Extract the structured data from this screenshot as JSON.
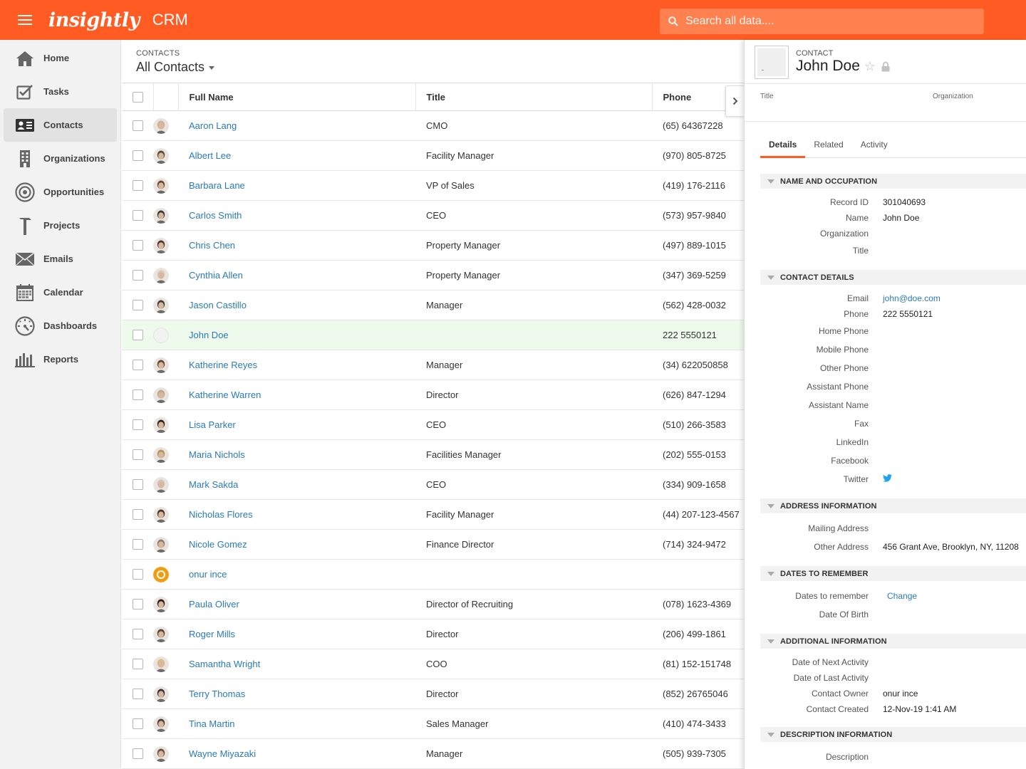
{
  "topbar": {
    "logo": "insightly",
    "product": "CRM",
    "search_placeholder": "Search all data...."
  },
  "sidebar": {
    "items": [
      {
        "label": "Home",
        "icon": "home-icon"
      },
      {
        "label": "Tasks",
        "icon": "tasks-icon"
      },
      {
        "label": "Contacts",
        "icon": "contacts-icon",
        "active": true
      },
      {
        "label": "Organizations",
        "icon": "building-icon"
      },
      {
        "label": "Opportunities",
        "icon": "target-icon"
      },
      {
        "label": "Projects",
        "icon": "hammer-icon"
      },
      {
        "label": "Emails",
        "icon": "envelope-icon"
      },
      {
        "label": "Calendar",
        "icon": "calendar-icon"
      },
      {
        "label": "Dashboards",
        "icon": "gauge-icon"
      },
      {
        "label": "Reports",
        "icon": "bar-chart-icon"
      }
    ]
  },
  "list": {
    "crumb": "CONTACTS",
    "view_title": "All Contacts",
    "columns": [
      "Full Name",
      "Title",
      "Phone"
    ],
    "rows": [
      {
        "name": "Aaron Lang",
        "title": "CMO",
        "phone": "(65) 64367228",
        "avatar": "#c9b39d"
      },
      {
        "name": "Albert Lee",
        "title": "Facility Manager",
        "phone": "(970) 805-8725",
        "avatar": "#5a4a44"
      },
      {
        "name": "Barbara Lane",
        "title": "VP of Sales",
        "phone": "(419) 176-2116",
        "avatar": "#6b4a35"
      },
      {
        "name": "Carlos Smith",
        "title": "CEO",
        "phone": "(573) 957-9840",
        "avatar": "#3a3a3a"
      },
      {
        "name": "Chris Chen",
        "title": "Property Manager",
        "phone": "(497) 889-1015",
        "avatar": "#4a3a30"
      },
      {
        "name": "Cynthia Allen",
        "title": "Property Manager",
        "phone": "(347) 369-5259",
        "avatar": "#d8c8b8"
      },
      {
        "name": "Jason Castillo",
        "title": "Manager",
        "phone": "(562) 428-0032",
        "avatar": "#3f3f3f"
      },
      {
        "name": "John Doe",
        "title": "",
        "phone": "222 5550121",
        "avatar": "#eeeeee",
        "selected": true
      },
      {
        "name": "Katherine Reyes",
        "title": "Manager",
        "phone": "(34) 622050858",
        "avatar": "#5b4637"
      },
      {
        "name": "Katherine Warren",
        "title": "Director",
        "phone": "(626) 847-1294",
        "avatar": "#c0a890"
      },
      {
        "name": "Lisa Parker",
        "title": "CEO",
        "phone": "(510) 266-3583",
        "avatar": "#2f2622"
      },
      {
        "name": "Maria Nichols",
        "title": "Facilities Manager",
        "phone": "(202) 555-0153",
        "avatar": "#b8925e"
      },
      {
        "name": "Mark Sakda",
        "title": "CEO",
        "phone": "(334) 909-1658",
        "avatar": "#cfc3b8"
      },
      {
        "name": "Nicholas Flores",
        "title": "Facility Manager",
        "phone": "(44) 207-123-4567",
        "avatar": "#4a3528"
      },
      {
        "name": "Nicole Gomez",
        "title": "Finance Director",
        "phone": "(714) 324-9472",
        "avatar": "#8c7d70"
      },
      {
        "name": "onur ince",
        "title": "",
        "phone": "",
        "avatar": "#f39c12",
        "initial": "O"
      },
      {
        "name": "Paula Oliver",
        "title": "Director of Recruiting",
        "phone": "(078) 1623-4369",
        "avatar": "#2e1f1a"
      },
      {
        "name": "Roger Mills",
        "title": "Director",
        "phone": "(206) 499-1861",
        "avatar": "#5a3e30"
      },
      {
        "name": "Samantha Wright",
        "title": "COO",
        "phone": "(81) 152-151748",
        "avatar": "#e0b88a"
      },
      {
        "name": "Terry Thomas",
        "title": "Director",
        "phone": "(852) 26765046",
        "avatar": "#3a3040"
      },
      {
        "name": "Tina Martin",
        "title": "Sales Manager",
        "phone": "(410) 474-3433",
        "avatar": "#4a4040"
      },
      {
        "name": "Wayne Miyazaki",
        "title": "Manager",
        "phone": "(505) 939-7305",
        "avatar": "#6a5040"
      }
    ]
  },
  "detail": {
    "crumb": "CONTACT",
    "name": "John Doe",
    "sub_title_label": "Title",
    "sub_org_label": "Organization",
    "tabs": [
      "Details",
      "Related",
      "Activity"
    ],
    "sections": [
      {
        "title": "NAME AND OCCUPATION",
        "fields": [
          {
            "label": "Record ID",
            "value": "301040693"
          },
          {
            "label": "Name",
            "value": "John Doe"
          },
          {
            "label": "Organization",
            "value": ""
          },
          {
            "label": "Title",
            "value": "",
            "tall": true
          }
        ]
      },
      {
        "title": "CONTACT DETAILS",
        "fields": [
          {
            "label": "Email",
            "value": "john@doe.com",
            "link": true
          },
          {
            "label": "Phone",
            "value": "222 5550121"
          },
          {
            "label": "Home Phone",
            "value": "",
            "tall": true
          },
          {
            "label": "Mobile Phone",
            "value": "",
            "tall": true
          },
          {
            "label": "Other Phone",
            "value": "",
            "tall": true
          },
          {
            "label": "Assistant Phone",
            "value": "",
            "tall": true
          },
          {
            "label": "Assistant Name",
            "value": "",
            "tall": true
          },
          {
            "label": "Fax",
            "value": "",
            "tall": true
          },
          {
            "label": "LinkedIn",
            "value": "",
            "tall": true
          },
          {
            "label": "Facebook",
            "value": "",
            "tall": true
          },
          {
            "label": "Twitter",
            "value": "",
            "tall": true,
            "icon": "twitter-icon"
          }
        ]
      },
      {
        "title": "ADDRESS INFORMATION",
        "fields": [
          {
            "label": "Mailing Address",
            "value": "",
            "tall": true
          },
          {
            "label": "Other Address",
            "value": "456 Grant Ave, Brooklyn, NY, 11208",
            "tall": true
          }
        ]
      },
      {
        "title": "DATES TO REMEMBER",
        "fields": [
          {
            "label": "Dates to remember",
            "value": "Change",
            "link": true,
            "change": true,
            "tall": true
          },
          {
            "label": "Date Of Birth",
            "value": "",
            "tall": true
          }
        ]
      },
      {
        "title": "ADDITIONAL INFORMATION",
        "fields": [
          {
            "label": "Date of Next Activity",
            "value": ""
          },
          {
            "label": "Date of Last Activity",
            "value": ""
          },
          {
            "label": "Contact Owner",
            "value": "onur ince"
          },
          {
            "label": "Contact Created",
            "value": "12-Nov-19 1:41 AM"
          }
        ]
      },
      {
        "title": "DESCRIPTION INFORMATION",
        "fields": [
          {
            "label": "Description",
            "value": "",
            "tall": true
          }
        ]
      }
    ]
  },
  "colors": {
    "brand": "#ff5b22",
    "link": "#2a7ab9",
    "selected_row": "#eefbec"
  }
}
